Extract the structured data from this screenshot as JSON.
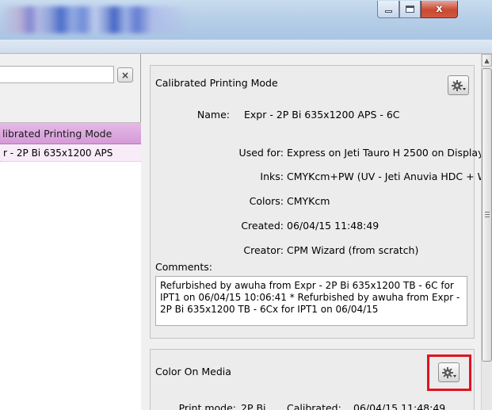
{
  "window": {
    "minimize_glyph": "minimize-icon",
    "maximize_glyph": "maximize-icon",
    "close_glyph": "x"
  },
  "left_pane": {
    "search": {
      "value": "",
      "placeholder": "",
      "clear_label": "×"
    },
    "list": {
      "header": "librated Printing Mode",
      "rows": [
        "r - 2P Bi 635x1200 APS"
      ]
    },
    "colors": {
      "header": "#d9a5db",
      "row": "#f8ecf8"
    }
  },
  "cpm_card": {
    "title": "Calibrated Printing Mode",
    "fields": [
      {
        "label": "Name:",
        "value": "Expr - 2P Bi 635x1200 APS - 6C"
      },
      {
        "label": "Used for:",
        "value": "Express on Jeti Tauro H 2500 on Display"
      },
      {
        "label": "Inks:",
        "value": "CMYKcm+PW (UV - Jeti Anuvia HDC + White"
      },
      {
        "label": "Colors:",
        "value": "CMYKcm"
      },
      {
        "label": "Created:",
        "value": "06/04/15 11:48:49"
      },
      {
        "label": "Creator:",
        "value": "CPM Wizard (from scratch)"
      }
    ],
    "comments_label": "Comments:",
    "comments_text": "Refurbished by awuha from Expr - 2P Bi 635x1200 TB - 6C for IPT1 on 06/04/15 10:06:41 * Refurbished by awuha from Expr - 2P Bi 635x1200 TB - 6Cx for IPT1 on 06/04/15"
  },
  "com_card": {
    "title": "Color On Media",
    "print_mode_label": "Print mode:",
    "print_mode_value": "2P Bi",
    "calibrated_label": "Calibrated:",
    "calibrated_value": "06/04/15 11:48:49"
  },
  "icons": {
    "gear": "gear-dropdown-icon",
    "scroll_up": "arrow-up-icon"
  },
  "accent": {
    "highlight_box": "#e0131f"
  }
}
